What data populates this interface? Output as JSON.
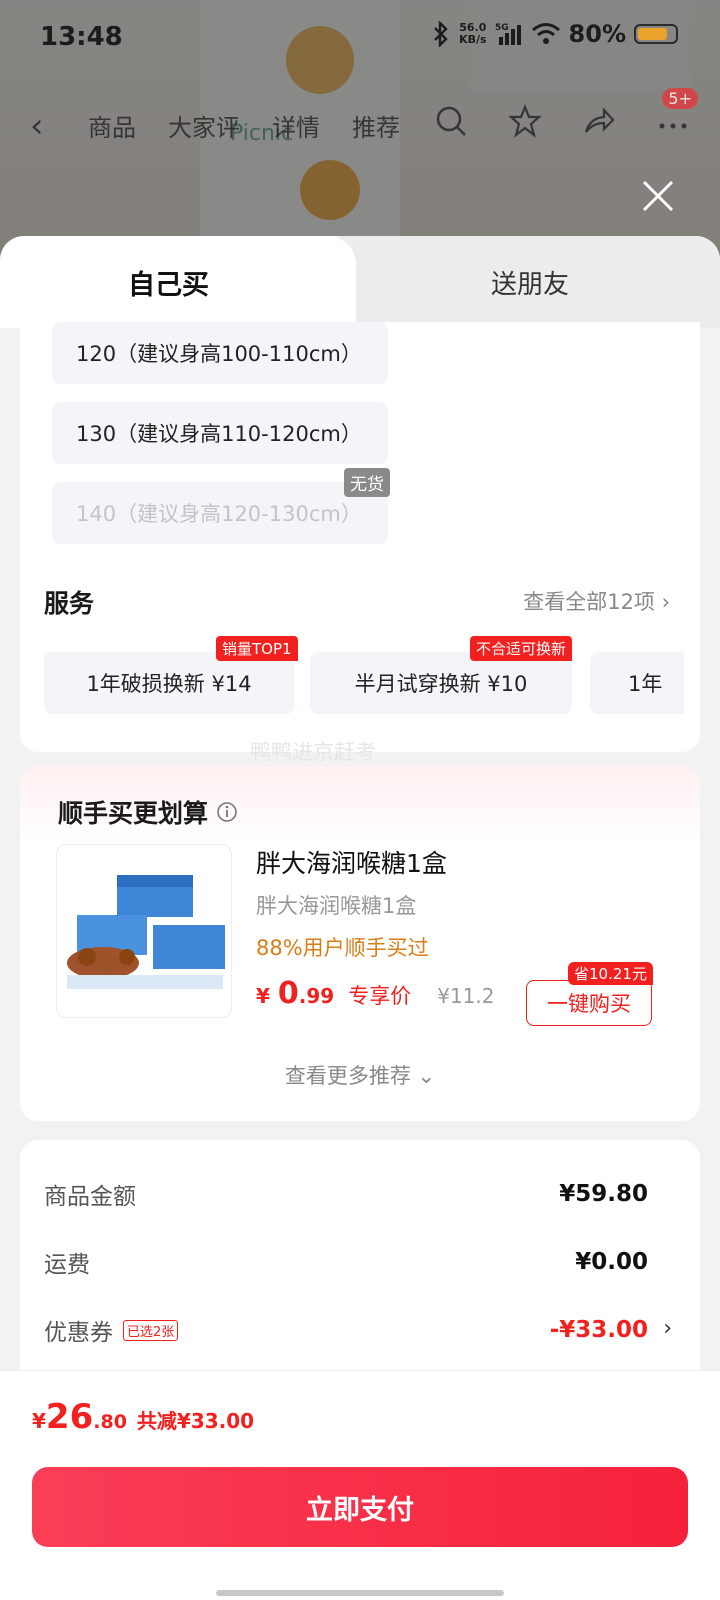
{
  "status_bar": {
    "time": "13:48",
    "speed_top": "56.0",
    "speed_unit": "KB/s",
    "network": "5G",
    "battery": "80%"
  },
  "nav": {
    "tabs": [
      "商品",
      "大家评",
      "详情",
      "推荐"
    ],
    "badge": "5+"
  },
  "sheet": {
    "tab_self": "自己买",
    "tab_gift": "送朋友",
    "sizes": [
      {
        "label": "120（建议身高100-110cm）",
        "available": true
      },
      {
        "label": "130（建议身高110-120cm）",
        "available": true
      },
      {
        "label": "140（建议身高120-130cm）",
        "available": false
      }
    ],
    "out_of_stock": "无货",
    "service": {
      "title": "服务",
      "more": "查看全部12项 ›",
      "items": [
        {
          "label": "1年破损换新  ¥14",
          "tag": "销量TOP1"
        },
        {
          "label": "半月试穿换新  ¥10",
          "tag": "不合适可换新"
        },
        {
          "label": "1年"
        }
      ]
    },
    "watermark": "鸭鸭进京赶考"
  },
  "addon": {
    "title": "顺手买更划算",
    "product_name": "胖大海润喉糖1盒",
    "product_sub": "胖大海润喉糖1盒",
    "social": "88%用户顺手买过",
    "price_cur": "¥",
    "price_int": "0",
    "price_dec": ".99",
    "price_label": "专享价",
    "price_orig": "¥11.2",
    "save_tag": "省10.21元",
    "buy_label": "一键购买",
    "more": "查看更多推荐 ⌄"
  },
  "bill": {
    "goods_label": "商品金额",
    "goods_value": "¥59.80",
    "ship_label": "运费",
    "ship_value": "¥0.00",
    "coupon_label": "优惠券",
    "coupon_tag": "已选2张",
    "coupon_value": "-¥33.00"
  },
  "footer": {
    "total_cur": "¥",
    "total_int": "26",
    "total_dec": ".80",
    "reduce": "共减¥33.00",
    "pay": "立即支付"
  }
}
